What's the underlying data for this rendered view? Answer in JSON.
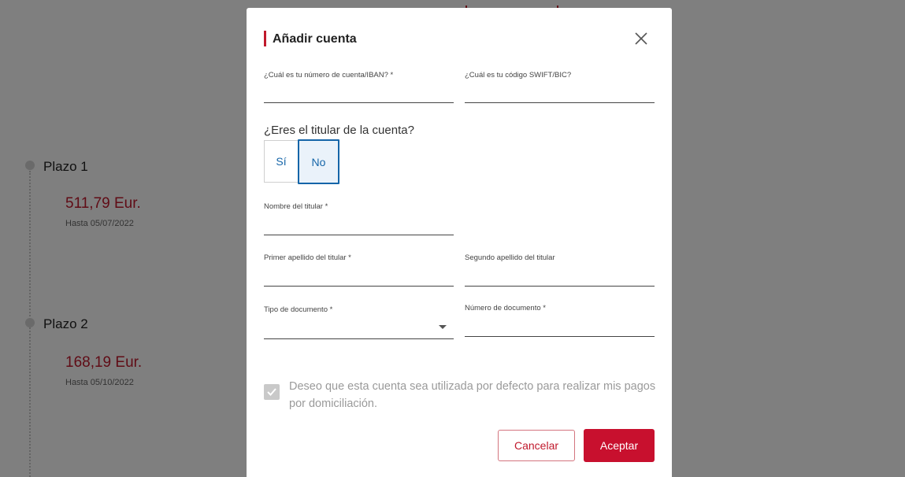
{
  "timeline": {
    "items": [
      {
        "title": "Plazo 1",
        "amount": "511,79 Eur.",
        "until": "Hasta 05/07/2022"
      },
      {
        "title": "Plazo 2",
        "amount": "168,19 Eur.",
        "until": "Hasta 05/10/2022"
      }
    ]
  },
  "modal": {
    "title": "Añadir cuenta",
    "iban_label": "¿Cuál es tu número de cuenta/IBAN? *",
    "iban_value": "",
    "swift_label": "¿Cuál es tu código SWIFT/BIC?",
    "swift_value": "",
    "holder_question": "¿Eres el titular de la cuenta?",
    "option_yes": "Sí",
    "option_no": "No",
    "selected_option": "No",
    "holder_name_label": "Nombre del titular *",
    "holder_name_value": "",
    "first_surname_label": "Primer apellido del titular *",
    "first_surname_value": "",
    "second_surname_label": "Segundo apellido del titular",
    "second_surname_value": "",
    "doc_type_label": "Tipo de documento *",
    "doc_type_value": "",
    "doc_number_label": "Número de documento *",
    "doc_number_value": "",
    "default_account_label": "Deseo que esta cuenta sea utilizada por defecto para realizar mis pagos por domiciliación.",
    "default_account_checked": true,
    "cancel_label": "Cancelar",
    "accept_label": "Aceptar"
  },
  "icons": {
    "close": "close-icon",
    "dropdown": "chevron-down-icon",
    "check": "check-icon"
  },
  "colors": {
    "accent": "#c8102e",
    "selected": "#1565a8",
    "overlay": "rgba(0,0,0,0.5)"
  }
}
